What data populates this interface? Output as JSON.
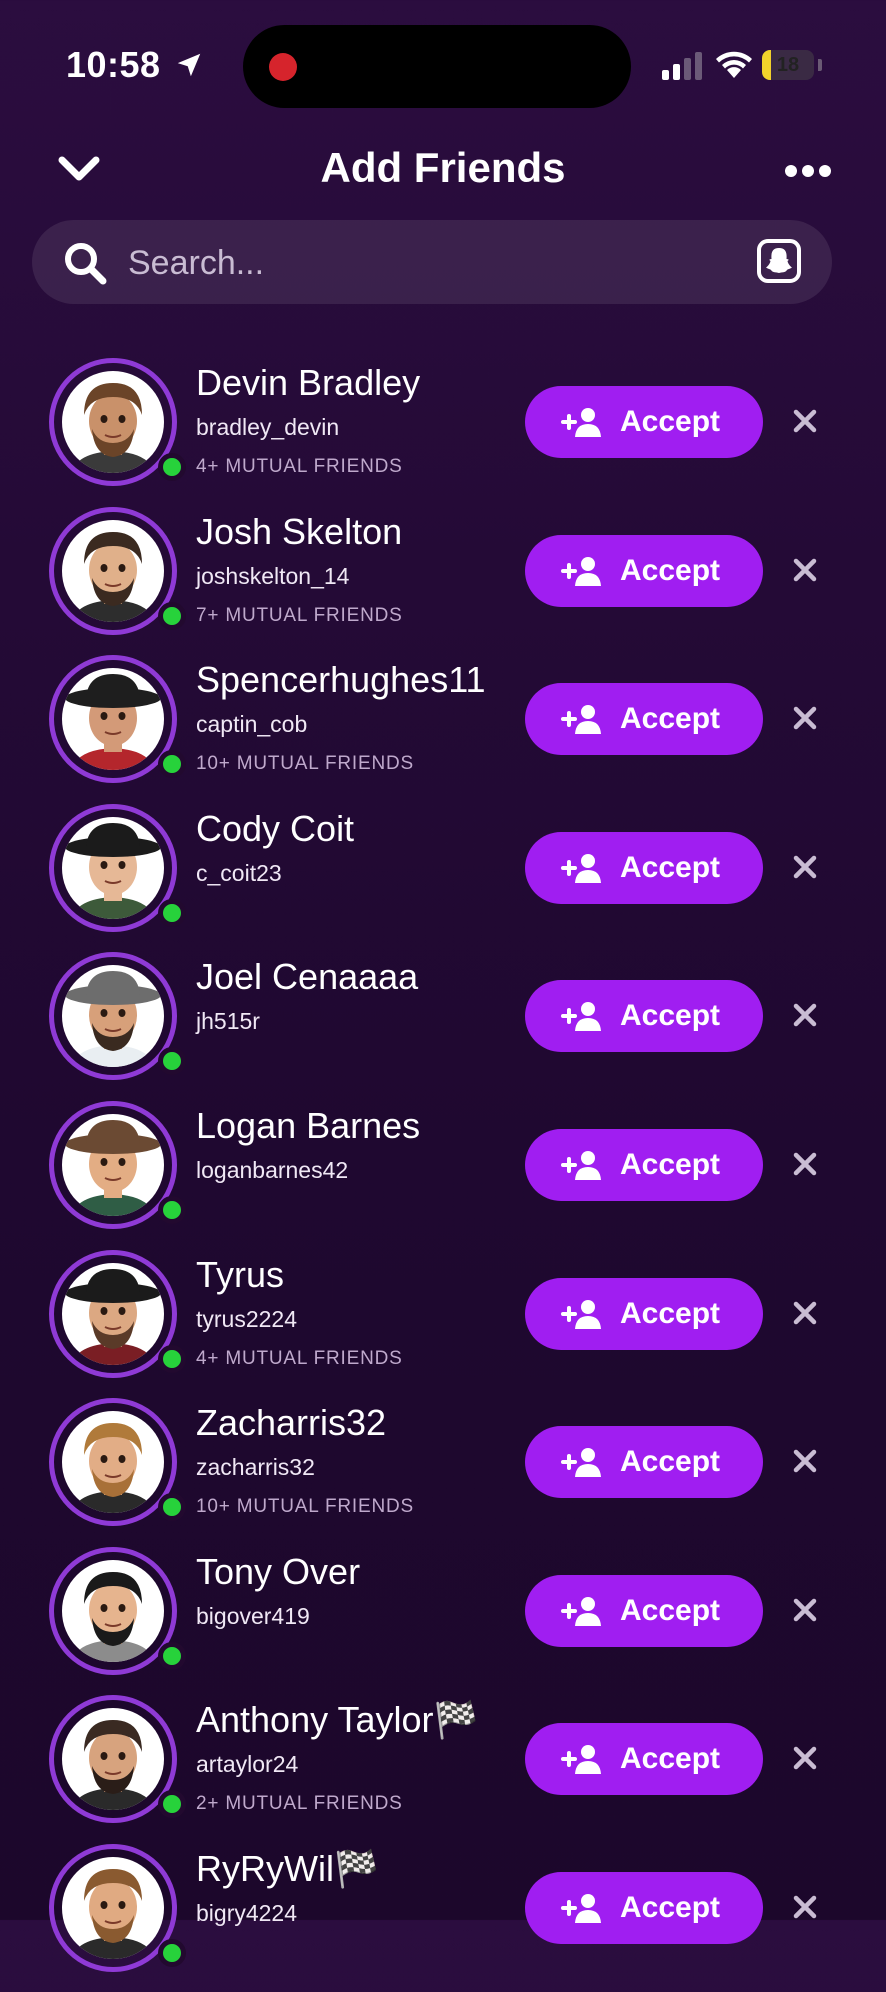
{
  "status_bar": {
    "time": "10:58",
    "battery": "18",
    "battery_level": 0.18
  },
  "header": {
    "title": "Add Friends"
  },
  "search": {
    "placeholder": "Search..."
  },
  "accept_label": "Accept",
  "friends": [
    {
      "name": "Devin Bradley",
      "username": "bradley_devin",
      "mutual": "4+ MUTUAL FRIENDS",
      "skin": "#c9916a",
      "hair": "#6b4428",
      "shirt": "#3a3a3a",
      "hat": "",
      "beard": "#6b4428"
    },
    {
      "name": "Josh Skelton",
      "username": "joshskelton_14",
      "mutual": "7+ MUTUAL FRIENDS",
      "skin": "#e0b08a",
      "hair": "#3b2a20",
      "shirt": "#2d2d2d",
      "hat": "",
      "beard": "#3b2a20"
    },
    {
      "name": "Spencerhughes11",
      "username": "captin_cob",
      "mutual": "10+ MUTUAL FRIENDS",
      "skin": "#d39a78",
      "hair": "#2a2a2a",
      "shirt": "#b4262c",
      "hat": "#1e1e1e",
      "beard": ""
    },
    {
      "name": "Cody Coit",
      "username": "c_coit23",
      "mutual": "",
      "skin": "#e6b896",
      "hair": "#1a1a1a",
      "shirt": "#3d5a3a",
      "hat": "#1b1b1b",
      "beard": ""
    },
    {
      "name": "Joel Cenaaaa",
      "username": "jh515r",
      "mutual": "",
      "skin": "#d7a07a",
      "hair": "#555",
      "shirt": "#e9eef2",
      "hat": "#6d6d6d",
      "beard": "#3a2a20"
    },
    {
      "name": "Logan Barnes",
      "username": "loganbarnes42",
      "mutual": "",
      "skin": "#e3ad84",
      "hair": "#5a3a28",
      "shirt": "#2f5d45",
      "hat": "#6b4a33",
      "beard": ""
    },
    {
      "name": "Tyrus",
      "username": "tyrus2224",
      "mutual": "4+ MUTUAL FRIENDS",
      "skin": "#dca882",
      "hair": "#1a1a1a",
      "shirt": "#7a1e24",
      "hat": "#1b1b1b",
      "beard": "#5a3a28"
    },
    {
      "name": "Zacharris32",
      "username": "zacharris32",
      "mutual": "10+ MUTUAL FRIENDS",
      "skin": "#e2ad86",
      "hair": "#b07a3a",
      "shirt": "#2a2a2a",
      "hat": "",
      "beard": "#a87038"
    },
    {
      "name": "Tony Over",
      "username": "bigover419",
      "mutual": "",
      "skin": "#e6b48e",
      "hair": "#1a1a1a",
      "shirt": "#8c8c8c",
      "hat": "",
      "beard": "#1a1a1a"
    },
    {
      "name": "Anthony Taylor🏁",
      "username": "artaylor24",
      "mutual": "2+ MUTUAL FRIENDS",
      "skin": "#d7a37e",
      "hair": "#3a2a22",
      "shirt": "#2a2a2a",
      "hat": "",
      "beard": "#2a1d18"
    },
    {
      "name": "RyRyWil🏁",
      "username": "bigry4224",
      "mutual": "",
      "skin": "#e0aa82",
      "hair": "#8a5a30",
      "shirt": "#2a2a2a",
      "hat": "",
      "beard": "#8a5a30"
    }
  ]
}
